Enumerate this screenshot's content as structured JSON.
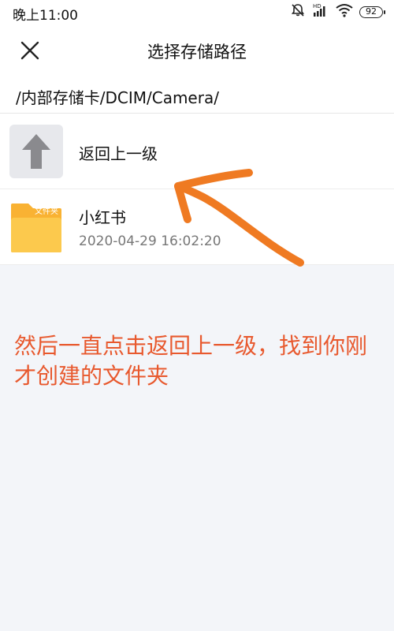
{
  "status_bar": {
    "time": "晚上11:00",
    "battery": "92",
    "icons": [
      "alarm-off-icon",
      "signal-hd-icon",
      "wifi-icon",
      "battery-icon"
    ],
    "hd_label": "HD"
  },
  "app_bar": {
    "title": "选择存储路径",
    "close_icon": "close-icon"
  },
  "path": "/内部存储卡/DCIM/Camera/",
  "list": {
    "up_item": {
      "label": "返回上一级",
      "icon": "up-arrow-icon"
    },
    "folder": {
      "name": "小红书",
      "date": "2020-04-29 16:02:20",
      "icon_label": "文件夹",
      "icon": "folder-icon"
    }
  },
  "annotation": {
    "text": "然后一直点击返回上一级，找到你刚才创建的文件夹",
    "color": "#e8592e"
  },
  "colors": {
    "folder": "#f9b233",
    "folder_light": "#fcc94d",
    "up_tile_bg": "#e7e8ec",
    "up_arrow": "#8a8a8e",
    "page_bg": "#f3f5f9"
  }
}
